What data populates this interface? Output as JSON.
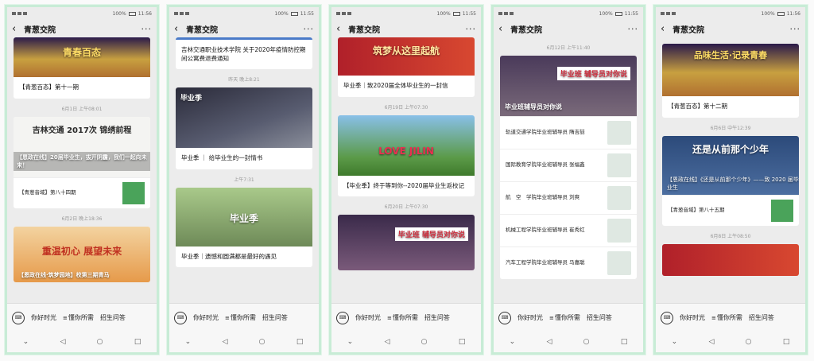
{
  "colors": {
    "accent": "#c8ecd6",
    "border": "#c8ecd6"
  },
  "common": {
    "title": "青葱交院",
    "time": "11:56",
    "battery": "100%",
    "menu": [
      "你好时光",
      "懂你所需",
      "招生问答"
    ],
    "nav_icons": [
      "back-triangle",
      "home-circle",
      "recent-square",
      "chevron-down"
    ]
  },
  "phones": [
    {
      "time": "11:56",
      "items": [
        {
          "type": "card",
          "image": "青春百态",
          "caption": "【青葱百态】第十一期"
        },
        {
          "type": "ts",
          "text": "6月1日 上午08:01"
        },
        {
          "type": "card",
          "image_title": "吉林交通 2017次 锦绣前程",
          "overlay": "【恩政在线】20届毕业生，拔开阴霾，我们一起向未来！",
          "caption": "【青葱音域】第八十四期"
        },
        {
          "type": "ts",
          "text": "6月2日 晚上18:36"
        },
        {
          "type": "card",
          "image_title": "重温初心 展望未来",
          "overlay": "【恩政在线·筑梦园地】校第三期青马"
        }
      ]
    },
    {
      "time": "11:55",
      "items": [
        {
          "type": "caption",
          "text": "吉林交通职业技术学院 关于2020年疫情防控期间公寓费退费通知"
        },
        {
          "type": "ts",
          "text": "昨天 晚上8:21"
        },
        {
          "type": "card",
          "image_title": "毕业季",
          "caption": "毕业季 ｜ 给毕业生的一封情书"
        },
        {
          "type": "ts",
          "text": "上午7:31"
        },
        {
          "type": "card",
          "image_title": "毕业季",
          "caption": "毕业季｜遗憾和圆满都是最好的遇见"
        }
      ]
    },
    {
      "time": "11:55",
      "items": [
        {
          "type": "card",
          "image_title": "筑梦从这里起航",
          "caption": "毕业季｜致2020届全体毕业生的一封信"
        },
        {
          "type": "ts",
          "text": "6月19日 上午07:30"
        },
        {
          "type": "card",
          "image_title": "LOVE JILIN",
          "caption": "【毕业季】终于等到你--2020届毕业生返校记"
        },
        {
          "type": "ts",
          "text": "6月20日 上午07:30"
        },
        {
          "type": "card",
          "image_title": "毕业班 辅导员对你说"
        }
      ]
    },
    {
      "time": "11:55",
      "items": [
        {
          "type": "ts",
          "text": "6月12日 上午11:40"
        },
        {
          "type": "card",
          "image_title": "毕业班 辅导员对你说",
          "overlay": "毕业班辅导员对你说",
          "subs": [
            "轨道交通学院毕业班辅导员 隋吉喆",
            "国际教育学院毕业班辅导员 张福鑫",
            "航　空　学院毕业班辅导员 刘爽",
            "机械工程学院毕业班辅导员 崔秀红",
            "汽车工程学院毕业班辅导员 马嘉聪"
          ]
        }
      ]
    },
    {
      "time": "11:56",
      "items": [
        {
          "type": "card",
          "image_title": "品味生活·记录青春",
          "caption": "【青葱百态】第十二期"
        },
        {
          "type": "ts",
          "text": "6月6日 中午12:39"
        },
        {
          "type": "card",
          "image_title": "还是从前那个少年",
          "overlay": "【恩政在线】《还是从前那个少年》——致 2020 届毕业生",
          "caption": "【青葱音域】第八十五期"
        },
        {
          "type": "ts",
          "text": "6月8日 上午08:50"
        },
        {
          "type": "card",
          "image_title": ""
        }
      ]
    }
  ]
}
